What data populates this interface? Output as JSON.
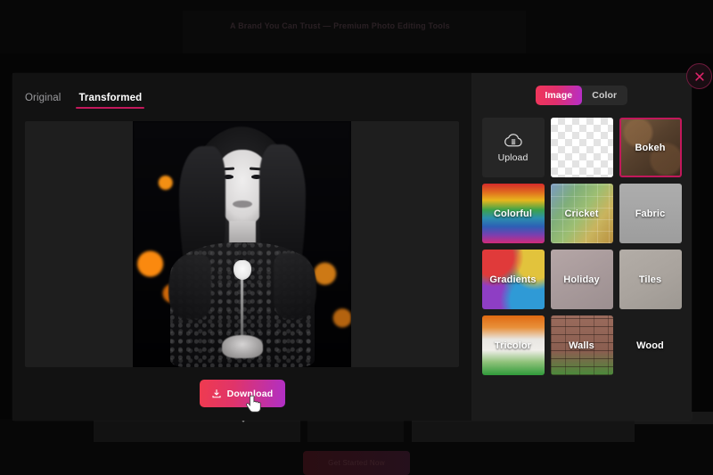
{
  "background": {
    "topbar_text": "A Brand You Can Trust — Premium Photo Editing Tools",
    "bottom_button_label": "Get Started Now"
  },
  "modal": {
    "tabs": [
      {
        "label": "Original",
        "active": false
      },
      {
        "label": "Transformed",
        "active": true
      }
    ],
    "download_button": {
      "label": "Download",
      "icon": "download-icon"
    },
    "close_button": {
      "icon": "close-icon"
    }
  },
  "panel": {
    "segments": [
      {
        "label": "Image",
        "active": true
      },
      {
        "label": "Color",
        "active": false
      }
    ],
    "backgrounds": [
      {
        "label": "Upload",
        "swatch": "upload",
        "icon": "cloud-upload-icon",
        "selected": false
      },
      {
        "label": "",
        "swatch": "transparent",
        "selected": false
      },
      {
        "label": "Bokeh",
        "swatch": "bokeh",
        "selected": true
      },
      {
        "label": "Colorful",
        "swatch": "colorful",
        "selected": false
      },
      {
        "label": "Cricket",
        "swatch": "cricket",
        "selected": false
      },
      {
        "label": "Fabric",
        "swatch": "fabric",
        "selected": false
      },
      {
        "label": "Gradients",
        "swatch": "gradients",
        "selected": false
      },
      {
        "label": "Holiday",
        "swatch": "holiday",
        "selected": false
      },
      {
        "label": "Tiles",
        "swatch": "tiles",
        "selected": false
      },
      {
        "label": "Tricolor",
        "swatch": "tricolor",
        "selected": false
      },
      {
        "label": "Walls",
        "swatch": "walls",
        "selected": false
      },
      {
        "label": "Wood",
        "swatch": "wood",
        "selected": false
      }
    ]
  },
  "colors": {
    "accent_pink": "#c2185b",
    "gradient_start": "#ef3b4f",
    "gradient_end": "#b02fc6",
    "panel_bg": "#1b1b1b",
    "modal_bg": "#121212",
    "canvas_bg": "#1e1e1e"
  }
}
